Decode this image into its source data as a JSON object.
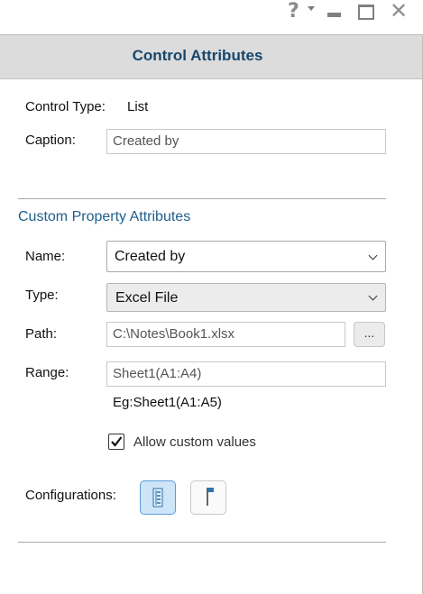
{
  "window_controls": {
    "help": "?",
    "close": "✕"
  },
  "panel": {
    "title": "Control Attributes"
  },
  "control": {
    "type_label": "Control Type:",
    "type_value": "List",
    "caption_label": "Caption:",
    "caption_value": "Created by"
  },
  "custom_property": {
    "section_title": "Custom Property Attributes",
    "name_label": "Name:",
    "name_value": "Created by",
    "type_label": "Type:",
    "type_value": "Excel File",
    "path_label": "Path:",
    "path_value": "C:\\Notes\\Book1.xlsx",
    "browse_label": "...",
    "range_label": "Range:",
    "range_value": "Sheet1(A1:A4)",
    "range_example": "Eg:Sheet1(A1:A5)",
    "allow_custom_label": "Allow custom values",
    "allow_custom_checked": true
  },
  "configurations": {
    "label": "Configurations:",
    "tools": [
      {
        "icon": "tree-view-icon",
        "active": true
      },
      {
        "icon": "flag-icon",
        "active": false
      }
    ]
  },
  "colors": {
    "header_bg": "#dcdcdc",
    "title_text": "#17476b",
    "section_text": "#1f5f8b",
    "active_tool_bg": "#cde5f7",
    "active_tool_border": "#5a9bd5"
  }
}
